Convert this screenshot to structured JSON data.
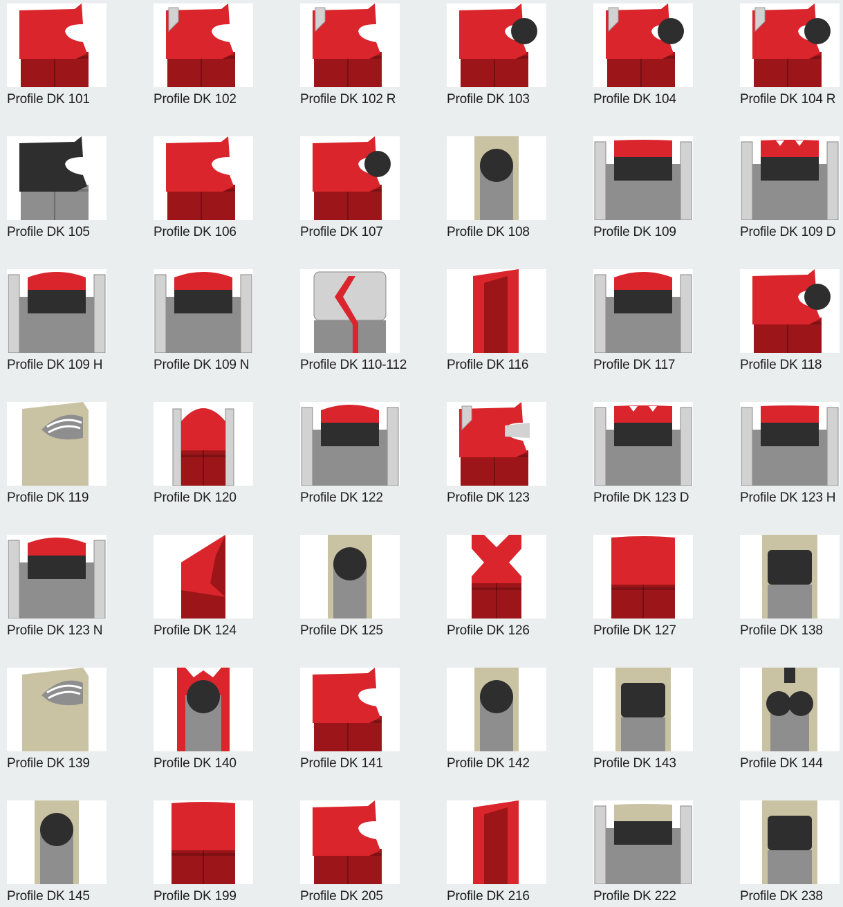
{
  "colors": {
    "background": "#ebeeee",
    "thumbnail_bg": "#ffffff",
    "red": "#d9252b",
    "dark_red": "#9c1519",
    "black": "#2e2e2e",
    "beige": "#c9c3a3",
    "light_grey": "#d2d2d2",
    "grey": "#8e8e8e"
  },
  "profiles": [
    {
      "label": "Profile DK 101",
      "material": "red",
      "style": "wiper"
    },
    {
      "label": "Profile DK 102",
      "material": "red",
      "style": "wiper-insert"
    },
    {
      "label": "Profile DK 102 R",
      "material": "red",
      "style": "wiper-insert"
    },
    {
      "label": "Profile DK 103",
      "material": "red",
      "style": "wiper-oring"
    },
    {
      "label": "Profile DK 104",
      "material": "red",
      "style": "wiper-insert-oring"
    },
    {
      "label": "Profile DK 104 R",
      "material": "red",
      "style": "wiper-insert-oring"
    },
    {
      "label": "Profile DK 105",
      "material": "black",
      "style": "wiper"
    },
    {
      "label": "Profile DK 106",
      "material": "red",
      "style": "wiper"
    },
    {
      "label": "Profile DK 107",
      "material": "red",
      "style": "wiper-oring"
    },
    {
      "label": "Profile DK 108",
      "material": "beige",
      "style": "oring-housing"
    },
    {
      "label": "Profile DK 109",
      "material": "red",
      "style": "flat-groove"
    },
    {
      "label": "Profile DK 109 D",
      "material": "red",
      "style": "notched-groove"
    },
    {
      "label": "Profile DK 109 H",
      "material": "red",
      "style": "dome-groove"
    },
    {
      "label": "Profile DK 109 N",
      "material": "red",
      "style": "dome-groove"
    },
    {
      "label": "Profile DK 110-112",
      "material": "grey",
      "style": "chevron"
    },
    {
      "label": "Profile DK 116",
      "material": "red",
      "style": "slim-lip"
    },
    {
      "label": "Profile DK 117",
      "material": "red",
      "style": "dome-groove"
    },
    {
      "label": "Profile DK 118",
      "material": "red",
      "style": "wiper-oring"
    },
    {
      "label": "Profile DK 119",
      "material": "beige",
      "style": "spring"
    },
    {
      "label": "Profile DK 120",
      "material": "red",
      "style": "round-top"
    },
    {
      "label": "Profile DK 122",
      "material": "red",
      "style": "dome-groove"
    },
    {
      "label": "Profile DK 123",
      "material": "red",
      "style": "wiper-insert-side"
    },
    {
      "label": "Profile DK 123 D",
      "material": "red",
      "style": "notched-groove"
    },
    {
      "label": "Profile DK 123 H",
      "material": "red",
      "style": "flat-groove"
    },
    {
      "label": "Profile DK 123 N",
      "material": "red",
      "style": "dome-groove"
    },
    {
      "label": "Profile DK 124",
      "material": "red",
      "style": "v-lip"
    },
    {
      "label": "Profile DK 125",
      "material": "beige",
      "style": "oring-housing"
    },
    {
      "label": "Profile DK 126",
      "material": "red",
      "style": "x-ring"
    },
    {
      "label": "Profile DK 127",
      "material": "red",
      "style": "block"
    },
    {
      "label": "Profile DK 138",
      "material": "beige",
      "style": "beige-black"
    },
    {
      "label": "Profile DK 139",
      "material": "beige",
      "style": "spring"
    },
    {
      "label": "Profile DK 140",
      "material": "red",
      "style": "notched-oring"
    },
    {
      "label": "Profile DK 141",
      "material": "red",
      "style": "wiper"
    },
    {
      "label": "Profile DK 142",
      "material": "beige",
      "style": "oring-housing"
    },
    {
      "label": "Profile DK 143",
      "material": "beige",
      "style": "beige-black"
    },
    {
      "label": "Profile DK 144",
      "material": "beige",
      "style": "double-oring"
    },
    {
      "label": "Profile DK 145",
      "material": "beige",
      "style": "oring-housing"
    },
    {
      "label": "Profile DK 199",
      "material": "red",
      "style": "block"
    },
    {
      "label": "Profile DK 205",
      "material": "red",
      "style": "wiper"
    },
    {
      "label": "Profile DK 216",
      "material": "red",
      "style": "slim-lip"
    },
    {
      "label": "Profile DK 222",
      "material": "beige",
      "style": "flat-groove"
    },
    {
      "label": "Profile DK 238",
      "material": "beige",
      "style": "beige-black"
    }
  ]
}
